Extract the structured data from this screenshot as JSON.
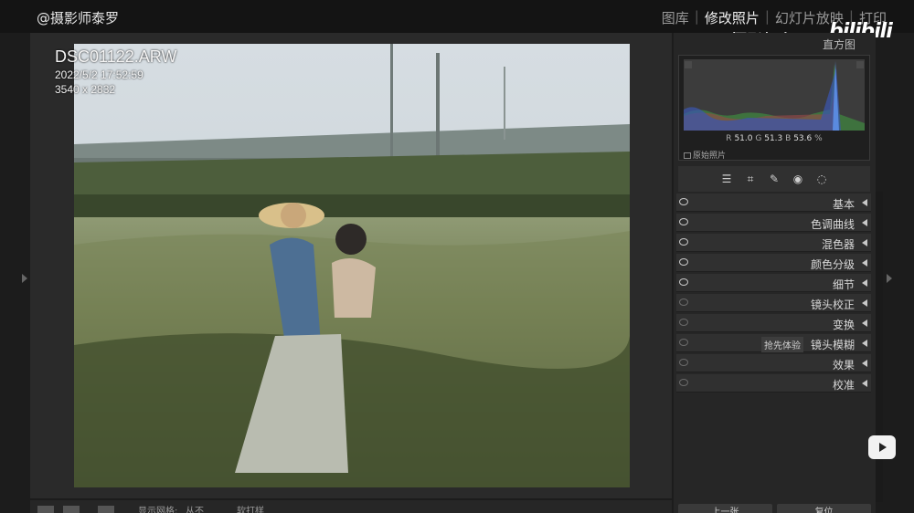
{
  "watermark": {
    "left": "@摄影师泰罗",
    "right": "摄影师泰罗",
    "logo": "bilibili"
  },
  "modules": [
    {
      "label": "图库",
      "active": false
    },
    {
      "label": "修改照片",
      "active": true
    },
    {
      "label": "幻灯片放映",
      "active": false
    },
    {
      "label": "打印",
      "active": false
    }
  ],
  "photo_info": {
    "filename": "DSC01122.ARW",
    "datetime": "2022/5/2 17:52:59",
    "dimensions": "3540 x 2832"
  },
  "histogram": {
    "label": "直方图",
    "r_label": "R",
    "r_value": "51.0",
    "g_label": "G",
    "g_value": "51.3",
    "b_label": "B",
    "b_value": "53.6",
    "unit": "%",
    "original_label": "原始照片"
  },
  "tool_icons": [
    "sliders-icon",
    "crop-icon",
    "heal-icon",
    "redeye-icon",
    "mask-icon"
  ],
  "sections": [
    {
      "label": "基本",
      "visible": true
    },
    {
      "label": "色调曲线",
      "visible": true
    },
    {
      "label": "混色器",
      "visible": true
    },
    {
      "label": "颜色分级",
      "visible": true
    },
    {
      "label": "细节",
      "visible": true
    },
    {
      "label": "镜头校正",
      "visible": false
    },
    {
      "label": "变换",
      "visible": false
    },
    {
      "label": "镜头模糊",
      "visible": false,
      "badge": "抢先体验"
    },
    {
      "label": "效果",
      "visible": false
    },
    {
      "label": "校准",
      "visible": false
    }
  ],
  "toolbar": {
    "grid_label": "显示网格:",
    "grid_value": "从不",
    "softproof_label": "软打样"
  },
  "buttons": {
    "prev": "上一张",
    "reset": "复位"
  }
}
